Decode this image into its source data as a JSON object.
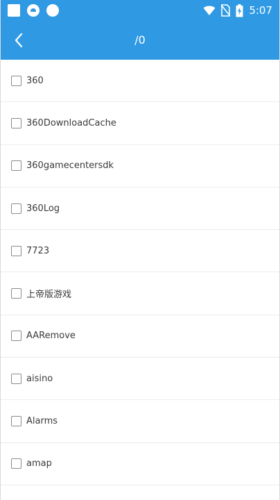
{
  "status_bar": {
    "time": "5:07",
    "left_icons": [
      "app-square-icon",
      "notification-badge-icon",
      "circle-icon"
    ],
    "right_icons": [
      "wifi-icon",
      "no-sim-icon",
      "battery-charging-icon"
    ]
  },
  "app_bar": {
    "back_icon": "chevron-left-icon",
    "title": "/0"
  },
  "files": [
    {
      "name": "360"
    },
    {
      "name": "360DownloadCache"
    },
    {
      "name": "360gamecentersdk"
    },
    {
      "name": "360Log"
    },
    {
      "name": "7723"
    },
    {
      "name": "上帝版游戏"
    },
    {
      "name": "AARemove"
    },
    {
      "name": "aisino"
    },
    {
      "name": "Alarms"
    },
    {
      "name": "amap"
    }
  ],
  "colors": {
    "primary": "#2f9ae3",
    "text": "#3a3a3a",
    "divider": "#ececec",
    "checkbox_border": "#8a8a8a"
  }
}
